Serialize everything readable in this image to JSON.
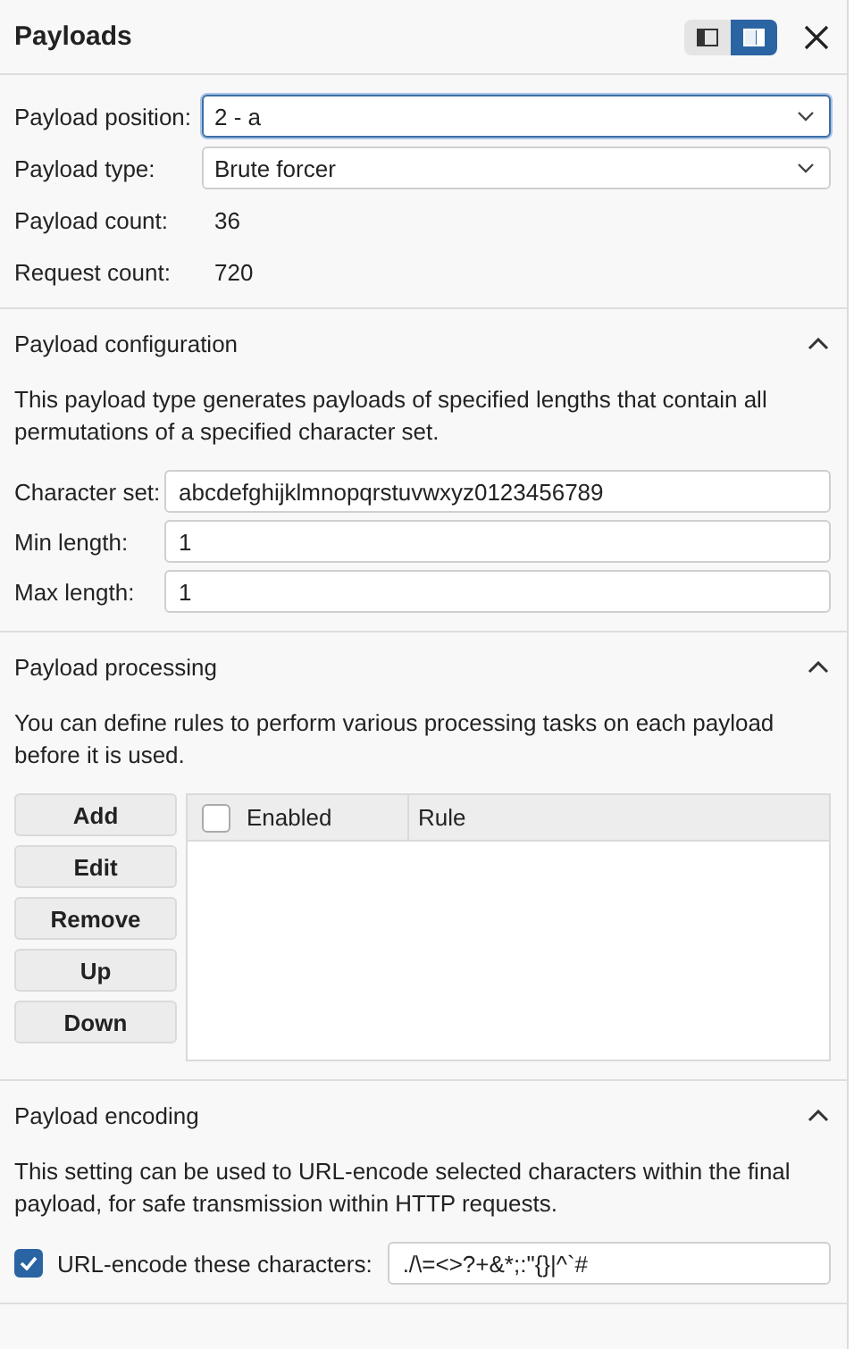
{
  "panel": {
    "title": "Payloads",
    "view_toggle": [
      {
        "selected": false
      },
      {
        "selected": true
      }
    ]
  },
  "summary": {
    "fields": [
      {
        "kind": "select",
        "label": "Payload position:",
        "value": "2 - a",
        "focused": true
      },
      {
        "kind": "select",
        "label": "Payload type:",
        "value": "Brute forcer",
        "focused": false
      },
      {
        "kind": "text",
        "label": "Payload count:",
        "value": "36"
      },
      {
        "kind": "text",
        "label": "Request count:",
        "value": "720"
      }
    ]
  },
  "sections": [
    {
      "kind": "config",
      "title": "Payload configuration",
      "expanded": true,
      "description": "This payload type generates payloads of specified lengths that contain all permutations of a specified character set.",
      "fields": [
        {
          "label": "Character set:",
          "value": "abcdefghijklmnopqrstuvwxyz0123456789"
        },
        {
          "label": "Min length:",
          "value": "1"
        },
        {
          "label": "Max length:",
          "value": "1"
        }
      ]
    },
    {
      "kind": "processing",
      "title": "Payload processing",
      "expanded": true,
      "description": "You can define rules to perform various processing tasks on each payload before it is used.",
      "buttons": [
        "Add",
        "Edit",
        "Remove",
        "Up",
        "Down"
      ],
      "table": {
        "all_checked": false,
        "columns": [
          "Enabled",
          "Rule"
        ]
      }
    },
    {
      "kind": "encoding",
      "title": "Payload encoding",
      "expanded": true,
      "description": "This setting can be used to URL-encode selected characters within the final payload, for safe transmission within HTTP requests.",
      "option": {
        "label": "URL-encode these characters:",
        "checked": true,
        "value": "./\\=<>?+&*;:\"{}|^`#"
      }
    }
  ]
}
